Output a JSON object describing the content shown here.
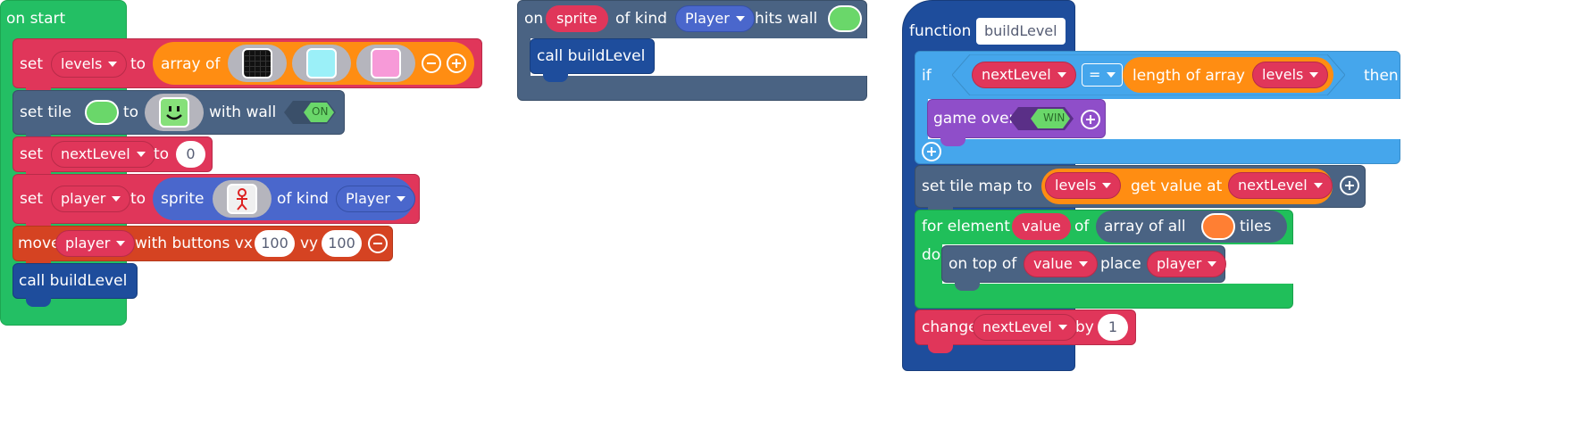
{
  "on_start": {
    "hat_label": "on start",
    "set_levels": {
      "set": "set",
      "var": "levels",
      "to": "to",
      "array_of": "array of",
      "images": [
        "dark-grid-tilemap-image",
        "light-cyan-tilemap-image",
        "pink-tilemap-image"
      ]
    },
    "set_tile": {
      "set": "set tile",
      "to": "to",
      "image": "smiley-wall-image",
      "with_wall": "with wall",
      "toggle": "ON"
    },
    "set_nextlevel": {
      "set": "set",
      "var": "nextLevel",
      "to": "to",
      "value": "0"
    },
    "set_player": {
      "set": "set",
      "var": "player",
      "to": "to",
      "sprite": "sprite",
      "image": "stick-figure-image",
      "of_kind": "of kind",
      "kind": "Player"
    },
    "move": {
      "move": "move",
      "var": "player",
      "with_buttons": "with buttons vx",
      "vx": "100",
      "vy_label": "vy",
      "vy": "100"
    },
    "call": {
      "call": "call buildLevel"
    }
  },
  "overlap": {
    "on": "on",
    "sprite": "sprite",
    "of_kind": "of kind",
    "kind": "Player",
    "hits_wall": "hits wall",
    "call": "call buildLevel"
  },
  "function": {
    "header": "function",
    "name": "buildLevel",
    "if": {
      "if": "if",
      "var": "nextLevel",
      "op": "=",
      "length_of_array": "length of array",
      "array_var": "levels",
      "then": "then"
    },
    "game_over": {
      "label": "game over",
      "toggle": "WIN"
    },
    "set_tilemap": {
      "label": "set tile map to",
      "var": "levels",
      "get_value_at": "get value at",
      "index": "nextLevel"
    },
    "for_element": {
      "label": "for element",
      "var": "value",
      "of": "of",
      "array_of_all": "array of all",
      "tiles": "tiles",
      "do": "do"
    },
    "on_top_of": {
      "label": "on top of",
      "var": "value",
      "place": "place",
      "sprite_var": "player"
    },
    "change": {
      "label": "change",
      "var": "nextLevel",
      "by": "by",
      "value": "1"
    }
  },
  "colors": {
    "event_green": "#23bf64",
    "variables_red": "#e0365a",
    "arrays_orange": "#ff8d12",
    "scene_slate": "#4a6383",
    "sprites_blue": "#4a67cc",
    "functions_navy": "#1e4d9c",
    "logic_sky": "#45a6ec",
    "game_purple": "#8f4ec9",
    "controller_orange": "#d54322",
    "loops_green": "#20bf5a",
    "toggle_green": "#6ad76a"
  }
}
